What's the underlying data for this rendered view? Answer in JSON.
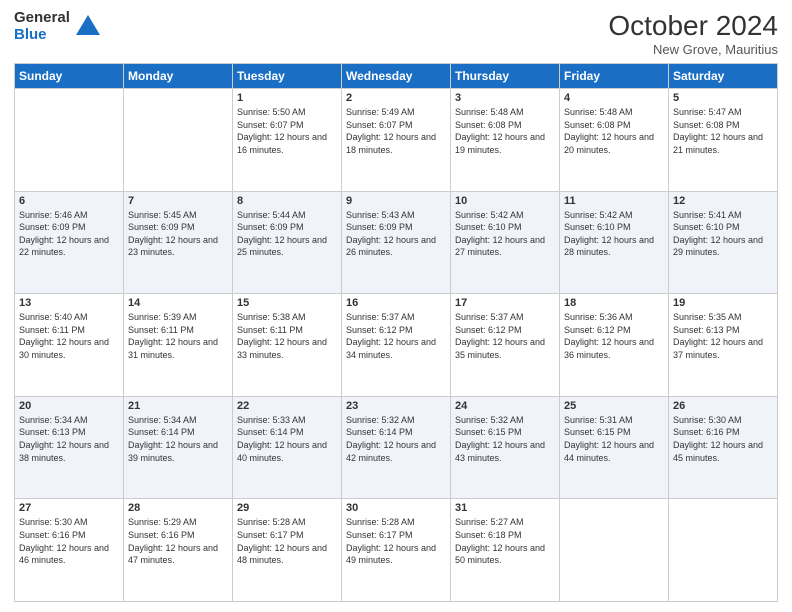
{
  "logo": {
    "general": "General",
    "blue": "Blue"
  },
  "header": {
    "month_year": "October 2024",
    "location": "New Grove, Mauritius"
  },
  "days_of_week": [
    "Sunday",
    "Monday",
    "Tuesday",
    "Wednesday",
    "Thursday",
    "Friday",
    "Saturday"
  ],
  "weeks": [
    [
      {
        "day": "",
        "info": ""
      },
      {
        "day": "",
        "info": ""
      },
      {
        "day": "1",
        "info": "Sunrise: 5:50 AM\nSunset: 6:07 PM\nDaylight: 12 hours and 16 minutes."
      },
      {
        "day": "2",
        "info": "Sunrise: 5:49 AM\nSunset: 6:07 PM\nDaylight: 12 hours and 18 minutes."
      },
      {
        "day": "3",
        "info": "Sunrise: 5:48 AM\nSunset: 6:08 PM\nDaylight: 12 hours and 19 minutes."
      },
      {
        "day": "4",
        "info": "Sunrise: 5:48 AM\nSunset: 6:08 PM\nDaylight: 12 hours and 20 minutes."
      },
      {
        "day": "5",
        "info": "Sunrise: 5:47 AM\nSunset: 6:08 PM\nDaylight: 12 hours and 21 minutes."
      }
    ],
    [
      {
        "day": "6",
        "info": "Sunrise: 5:46 AM\nSunset: 6:09 PM\nDaylight: 12 hours and 22 minutes."
      },
      {
        "day": "7",
        "info": "Sunrise: 5:45 AM\nSunset: 6:09 PM\nDaylight: 12 hours and 23 minutes."
      },
      {
        "day": "8",
        "info": "Sunrise: 5:44 AM\nSunset: 6:09 PM\nDaylight: 12 hours and 25 minutes."
      },
      {
        "day": "9",
        "info": "Sunrise: 5:43 AM\nSunset: 6:09 PM\nDaylight: 12 hours and 26 minutes."
      },
      {
        "day": "10",
        "info": "Sunrise: 5:42 AM\nSunset: 6:10 PM\nDaylight: 12 hours and 27 minutes."
      },
      {
        "day": "11",
        "info": "Sunrise: 5:42 AM\nSunset: 6:10 PM\nDaylight: 12 hours and 28 minutes."
      },
      {
        "day": "12",
        "info": "Sunrise: 5:41 AM\nSunset: 6:10 PM\nDaylight: 12 hours and 29 minutes."
      }
    ],
    [
      {
        "day": "13",
        "info": "Sunrise: 5:40 AM\nSunset: 6:11 PM\nDaylight: 12 hours and 30 minutes."
      },
      {
        "day": "14",
        "info": "Sunrise: 5:39 AM\nSunset: 6:11 PM\nDaylight: 12 hours and 31 minutes."
      },
      {
        "day": "15",
        "info": "Sunrise: 5:38 AM\nSunset: 6:11 PM\nDaylight: 12 hours and 33 minutes."
      },
      {
        "day": "16",
        "info": "Sunrise: 5:37 AM\nSunset: 6:12 PM\nDaylight: 12 hours and 34 minutes."
      },
      {
        "day": "17",
        "info": "Sunrise: 5:37 AM\nSunset: 6:12 PM\nDaylight: 12 hours and 35 minutes."
      },
      {
        "day": "18",
        "info": "Sunrise: 5:36 AM\nSunset: 6:12 PM\nDaylight: 12 hours and 36 minutes."
      },
      {
        "day": "19",
        "info": "Sunrise: 5:35 AM\nSunset: 6:13 PM\nDaylight: 12 hours and 37 minutes."
      }
    ],
    [
      {
        "day": "20",
        "info": "Sunrise: 5:34 AM\nSunset: 6:13 PM\nDaylight: 12 hours and 38 minutes."
      },
      {
        "day": "21",
        "info": "Sunrise: 5:34 AM\nSunset: 6:14 PM\nDaylight: 12 hours and 39 minutes."
      },
      {
        "day": "22",
        "info": "Sunrise: 5:33 AM\nSunset: 6:14 PM\nDaylight: 12 hours and 40 minutes."
      },
      {
        "day": "23",
        "info": "Sunrise: 5:32 AM\nSunset: 6:14 PM\nDaylight: 12 hours and 42 minutes."
      },
      {
        "day": "24",
        "info": "Sunrise: 5:32 AM\nSunset: 6:15 PM\nDaylight: 12 hours and 43 minutes."
      },
      {
        "day": "25",
        "info": "Sunrise: 5:31 AM\nSunset: 6:15 PM\nDaylight: 12 hours and 44 minutes."
      },
      {
        "day": "26",
        "info": "Sunrise: 5:30 AM\nSunset: 6:16 PM\nDaylight: 12 hours and 45 minutes."
      }
    ],
    [
      {
        "day": "27",
        "info": "Sunrise: 5:30 AM\nSunset: 6:16 PM\nDaylight: 12 hours and 46 minutes."
      },
      {
        "day": "28",
        "info": "Sunrise: 5:29 AM\nSunset: 6:16 PM\nDaylight: 12 hours and 47 minutes."
      },
      {
        "day": "29",
        "info": "Sunrise: 5:28 AM\nSunset: 6:17 PM\nDaylight: 12 hours and 48 minutes."
      },
      {
        "day": "30",
        "info": "Sunrise: 5:28 AM\nSunset: 6:17 PM\nDaylight: 12 hours and 49 minutes."
      },
      {
        "day": "31",
        "info": "Sunrise: 5:27 AM\nSunset: 6:18 PM\nDaylight: 12 hours and 50 minutes."
      },
      {
        "day": "",
        "info": ""
      },
      {
        "day": "",
        "info": ""
      }
    ]
  ]
}
